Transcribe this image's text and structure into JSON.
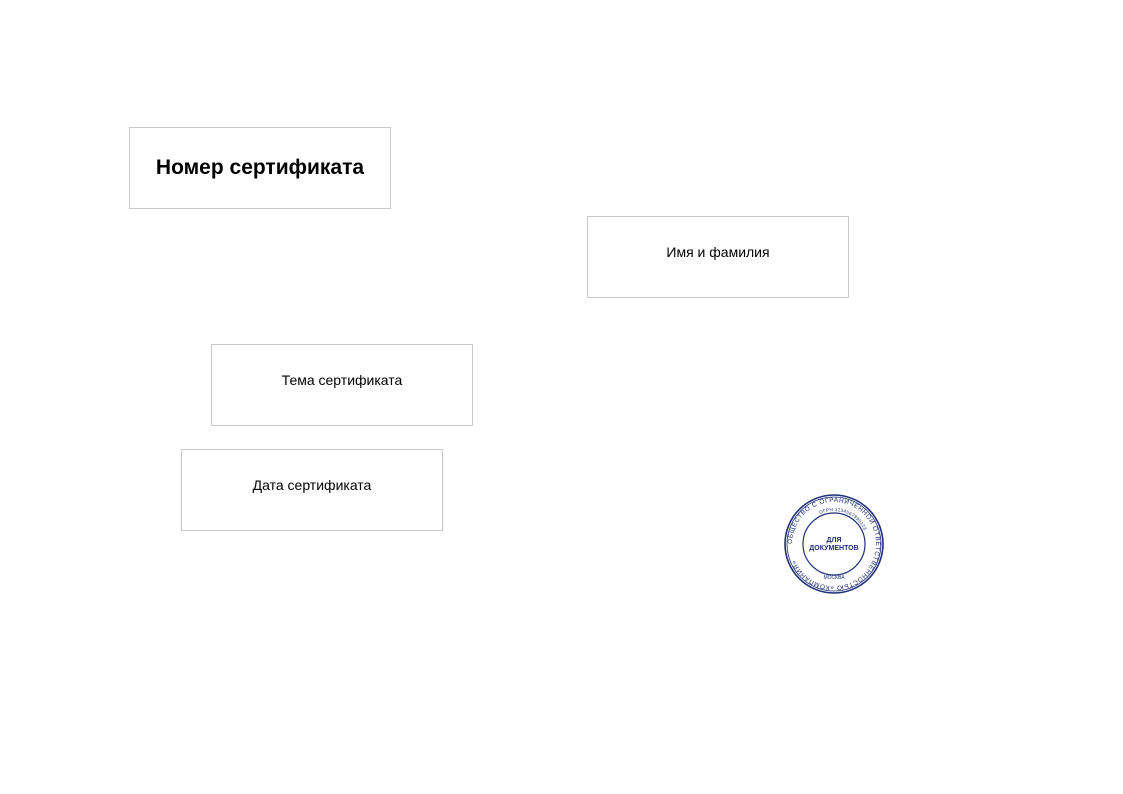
{
  "certificate": {
    "number_placeholder": "Номер сертификата",
    "name_placeholder": "Имя и фамилия",
    "topic_placeholder": "Тема сертификата",
    "date_placeholder": "Дата сертификата"
  },
  "stamp": {
    "center_line1": "ДЛЯ",
    "center_line2": "ДОКУМЕНТОВ",
    "outer_ring_text": "ОБЩЕСТВО С ОГРАНИЧЕННОЙ ОТВЕТСТВЕННОСТЬЮ «КОМПАНИЯ»",
    "inner_ring_text": "ОГРН 1234567890123",
    "bottom_text": "МОСКВА",
    "color": "#1f2f7a"
  }
}
